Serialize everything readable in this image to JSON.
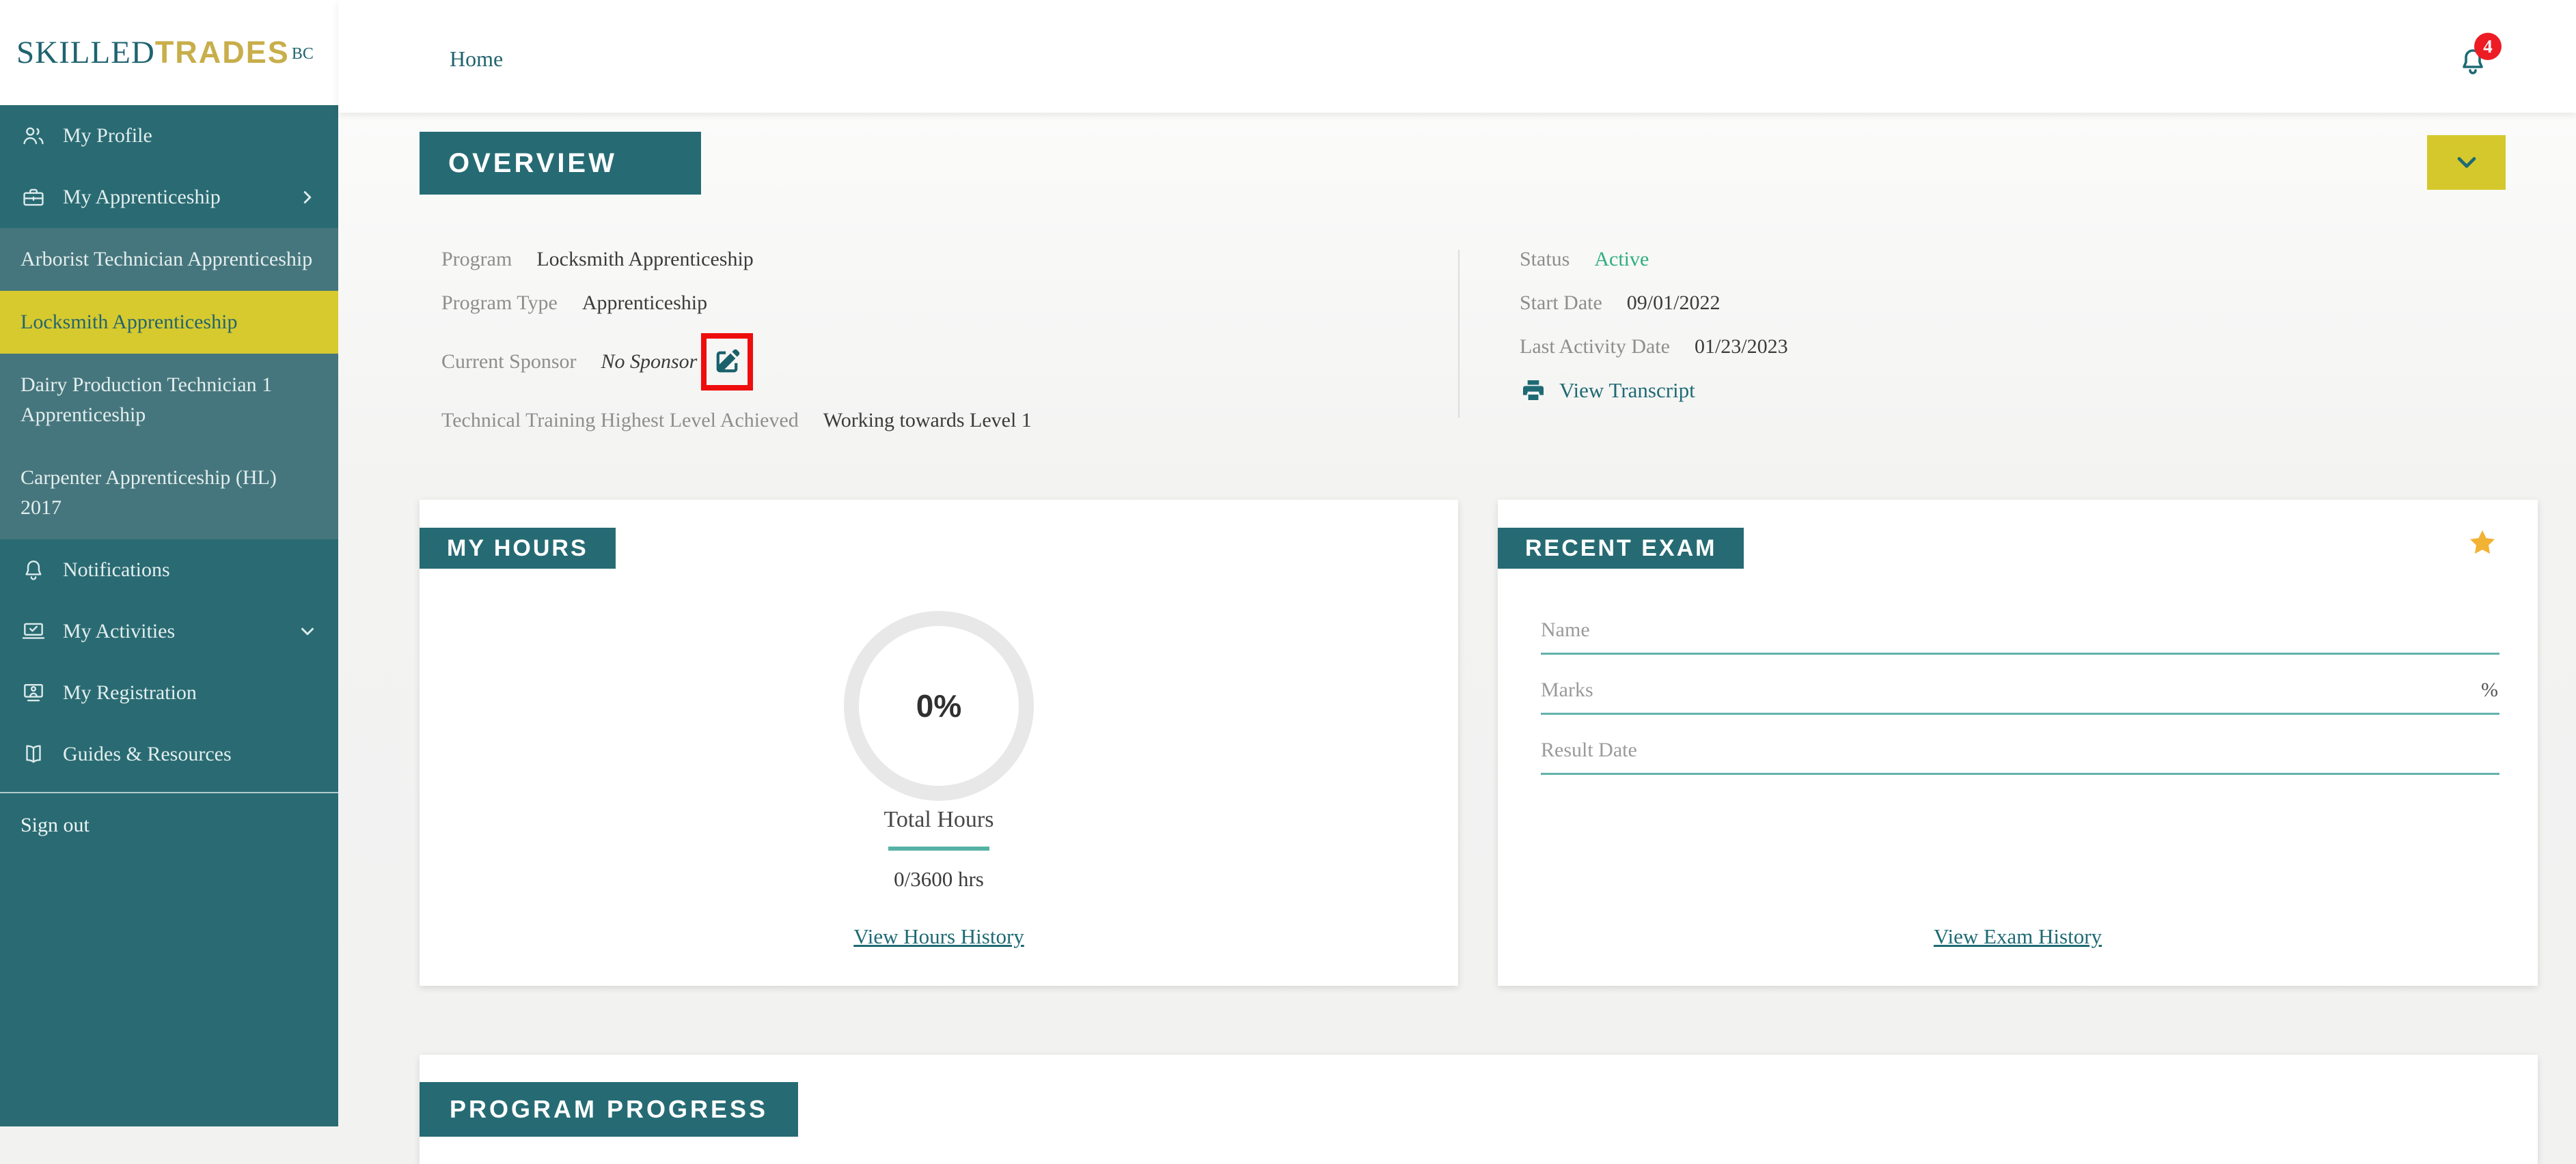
{
  "logo": {
    "skilled": "SKILLED",
    "trades": "TRADES",
    "bc": "BC"
  },
  "header": {
    "breadcrumb_home": "Home",
    "notification_count": "4"
  },
  "sidebar": {
    "my_profile": "My Profile",
    "my_apprenticeship": "My Apprenticeship",
    "programs": [
      "Arborist Technician Apprenticeship",
      "Locksmith Apprenticeship",
      "Dairy Production Technician 1 Apprenticeship",
      "Carpenter Apprenticeship (HL) 2017"
    ],
    "selected_program": "Locksmith Apprenticeship",
    "notifications": "Notifications",
    "my_activities": "My Activities",
    "my_registration": "My Registration",
    "guides_resources": "Guides & Resources",
    "sign_out": "Sign out"
  },
  "overview": {
    "title": "OVERVIEW",
    "program_label": "Program",
    "program_value": "Locksmith Apprenticeship",
    "program_type_label": "Program Type",
    "program_type_value": "Apprenticeship",
    "sponsor_label": "Current Sponsor",
    "sponsor_value": "No Sponsor",
    "training_label": "Technical Training Highest Level Achieved",
    "training_value": "Working towards Level 1",
    "status_label": "Status",
    "status_value": "Active",
    "start_date_label": "Start Date",
    "start_date_value": "09/01/2022",
    "last_activity_label": "Last Activity Date",
    "last_activity_value": "01/23/2023",
    "view_transcript": "View Transcript"
  },
  "my_hours": {
    "title": "MY HOURS",
    "percent": "0%",
    "percent_value": 0,
    "total_hours_label": "Total Hours",
    "hours_value": "0/3600 hrs",
    "hours_completed": 0,
    "hours_required": 3600,
    "view_history": "View Hours History"
  },
  "recent_exam": {
    "title": "RECENT EXAM",
    "name_label": "Name",
    "marks_label": "Marks",
    "marks_suffix": "%",
    "result_date_label": "Result Date",
    "view_history": "View Exam History"
  },
  "program_progress": {
    "title": "PROGRAM PROGRESS"
  },
  "icons": [
    "profile-icon",
    "briefcase-icon",
    "chevron-right-icon",
    "bell-icon",
    "laptop-check-icon",
    "registration-icon",
    "book-icon",
    "chevron-down-icon",
    "edit-icon",
    "printer-icon",
    "star-icon"
  ],
  "colors": {
    "sidebar_teal": "#2a6b73",
    "submenu_teal": "#46767d",
    "selected_yellow": "#d7ca2e",
    "badge_teal": "#266b74",
    "link_teal": "#1e6a74",
    "status_green": "#2fae7c",
    "notification_red": "#ed1c24",
    "annotation_red": "#ee0d0d",
    "star_gold": "#f2b234",
    "logo_gold": "#c8ae4b",
    "field_underline": "#62b2ab"
  }
}
